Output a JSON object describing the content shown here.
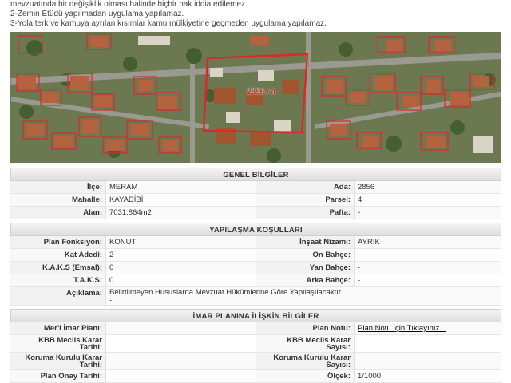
{
  "notes": [
    "mevzuatında bir değişiklik olması halinde hiçbir hak iddia edilemez.",
    "2-Zemin Etüdü yapılmadan uygulama yapılamaz.",
    "3-Yola terk ve kamuya ayrılan kısımlar kamu mülkiyetine geçmeden uygulama yapılamaz."
  ],
  "map": {
    "parcel_label": "2856 / 4"
  },
  "genel": {
    "title": "GENEL BİLGİLER",
    "ilce_label": "İlçe:",
    "ilce_value": "MERAM",
    "ada_label": "Ada:",
    "ada_value": "2856",
    "mahalle_label": "Mahalle:",
    "mahalle_value": "KAYADİBİ",
    "parsel_label": "Parsel:",
    "parsel_value": "4",
    "alan_label": "Alan:",
    "alan_value": "7031.864m2",
    "pafta_label": "Pafta:",
    "pafta_value": "-"
  },
  "yapilasma": {
    "title": "YAPILAŞMA KOŞULLARI",
    "plan_fonk_label": "Plan Fonksiyon:",
    "plan_fonk_value": "KONUT",
    "insaat_label": "İnşaat Nizamı:",
    "insaat_value": "AYRIK",
    "kat_label": "Kat Adedi:",
    "kat_value": "2",
    "on_bahce_label": "Ön Bahçe:",
    "on_bahce_value": "-",
    "kaks_label": "K.A.K.S (Emsal):",
    "kaks_value": "0",
    "yan_bahce_label": "Yan Bahçe:",
    "yan_bahce_value": "-",
    "taks_label": "T.A.K.S:",
    "taks_value": "0",
    "arka_bahce_label": "Arka Bahçe:",
    "arka_bahce_value": "-",
    "aciklama_label": "Açıklama:",
    "aciklama_value": "Belirtilmeyen Hususlarda Mevzuat Hükümlerine Göre Yapılaşılacaktır.",
    "aciklama_value2": "-"
  },
  "imar": {
    "title": "İMAR PLANINA İLİŞKİN BİLGİLER",
    "meri_label": "Mer'i İmar Planı:",
    "meri_value": "",
    "plan_notu_label": "Plan Notu:",
    "plan_notu_link": "Plan Notu İçin Tıklayınız...",
    "kbb_tarih_label1": "KBB Meclis Karar",
    "kbb_tarih_label2": "Tarihi:",
    "kbb_tarih_value": "",
    "kbb_sayi_label1": "KBB Meclis Karar",
    "kbb_sayi_label2": "Sayısı:",
    "kbb_sayi_value": "",
    "koruma_tarih_label1": "Koruma Kurulu Karar",
    "koruma_tarih_label2": "Tarihi:",
    "koruma_tarih_value": "",
    "koruma_sayi_label1": "Koruma Kurulu Karar",
    "koruma_sayi_label2": "Sayısı:",
    "koruma_sayi_value": "",
    "onay_label": "Plan Onay Tarihi:",
    "onay_value": "",
    "olcek_label": "Ölçek:",
    "olcek_value": "1/1000"
  },
  "colors": {
    "parcel_outline": "#e0262b",
    "header_bg": "#e6e6e6"
  }
}
